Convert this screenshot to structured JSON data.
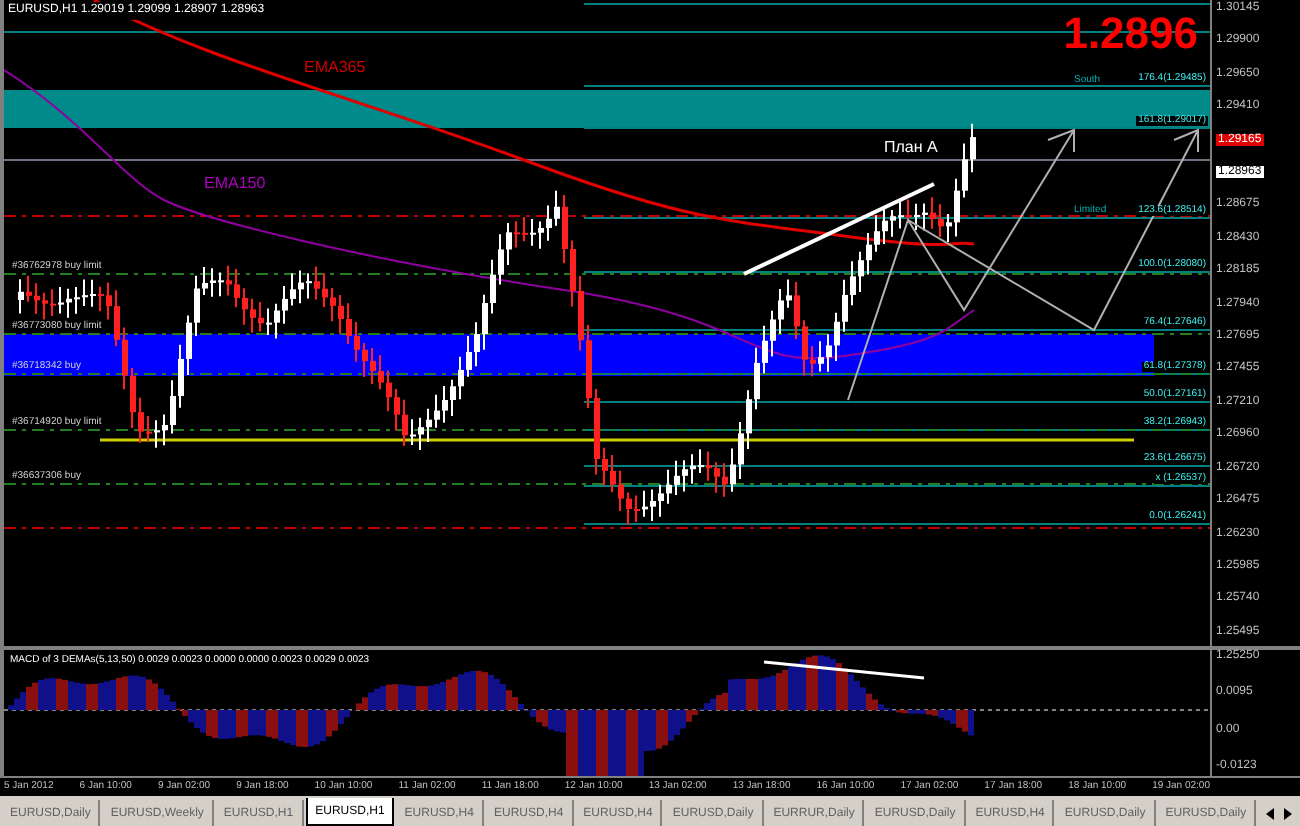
{
  "chart": {
    "header": "EURUSD,H1  1.29019 1.29099 1.28907 1.28963",
    "big_price": "1.2896",
    "indicator_labels": [
      {
        "text": "EMA365",
        "color": "#d00000"
      },
      {
        "text": "EMA150",
        "color": "#b000c0"
      }
    ],
    "plan_label": "План А",
    "zone_labels": [
      "South",
      "Limited"
    ],
    "fib_labels": [
      "176.4(1.29485)",
      "161.8(1.29017)",
      "123.6(1.28514)",
      "100.0(1.28080)",
      "76.4(1.27646)",
      "61.8(1.27378)",
      "50.0(1.27161)",
      "38.2(1.26943)",
      "23.6(1.26675)",
      "x (1.26537)",
      "0.0(1.26241)"
    ],
    "order_labels": [
      "#36762978 buy limit",
      "#36773080 buy limit",
      "#36718342 buy",
      "#36714920 buy limit",
      "#36637306 buy"
    ],
    "price_axis": [
      {
        "text": "1.30145",
        "kind": "plain"
      },
      {
        "text": "1.29900",
        "kind": "plain"
      },
      {
        "text": "1.29650",
        "kind": "plain"
      },
      {
        "text": "1.29410",
        "kind": "plain"
      },
      {
        "text": "1.29165",
        "kind": "alert"
      },
      {
        "text": "1.28963",
        "kind": "current"
      },
      {
        "text": "1.28675",
        "kind": "plain"
      },
      {
        "text": "1.28430",
        "kind": "plain"
      },
      {
        "text": "1.28185",
        "kind": "plain"
      },
      {
        "text": "1.27940",
        "kind": "plain"
      },
      {
        "text": "1.27695",
        "kind": "plain"
      },
      {
        "text": "1.27455",
        "kind": "plain"
      },
      {
        "text": "1.27210",
        "kind": "plain"
      },
      {
        "text": "1.26960",
        "kind": "plain"
      },
      {
        "text": "1.26720",
        "kind": "plain"
      },
      {
        "text": "1.26475",
        "kind": "plain"
      },
      {
        "text": "1.26230",
        "kind": "plain"
      },
      {
        "text": "1.25985",
        "kind": "plain"
      },
      {
        "text": "1.25740",
        "kind": "plain"
      },
      {
        "text": "1.25495",
        "kind": "plain"
      }
    ]
  },
  "macd": {
    "title": "MACD of 3 DEMAs(5,13,50) 0.0029 0.0023 0.0000 0.0000 0.0023 0.0029 0.0023",
    "axis": [
      "1.25250",
      "0.0095",
      "0.00",
      "-0.0123"
    ]
  },
  "time_axis": [
    "5 Jan 2012",
    "6 Jan 10:00",
    "9 Jan 02:00",
    "9 Jan 18:00",
    "10 Jan 10:00",
    "11 Jan 02:00",
    "11 Jan 18:00",
    "12 Jan 10:00",
    "13 Jan 02:00",
    "13 Jan 18:00",
    "16 Jan 10:00",
    "17 Jan 02:00",
    "17 Jan 18:00",
    "18 Jan 10:00",
    "19 Jan 02:00"
  ],
  "tabs": [
    {
      "label": "EURUSD,Daily",
      "selected": false
    },
    {
      "label": "EURUSD,Weekly",
      "selected": false
    },
    {
      "label": "EURUSD,H1",
      "selected": false
    },
    {
      "label": "EURUSD,H1",
      "selected": true
    },
    {
      "label": "EURUSD,H4",
      "selected": false
    },
    {
      "label": "EURUSD,H4",
      "selected": false
    },
    {
      "label": "EURUSD,H4",
      "selected": false
    },
    {
      "label": "EURUSD,Daily",
      "selected": false
    },
    {
      "label": "EURRUR,Daily",
      "selected": false
    },
    {
      "label": "EURUSD,Daily",
      "selected": false
    },
    {
      "label": "EURUSD,H4",
      "selected": false
    },
    {
      "label": "EURUSD,Daily",
      "selected": false
    },
    {
      "label": "EURUSD,Daily",
      "selected": false
    }
  ]
}
